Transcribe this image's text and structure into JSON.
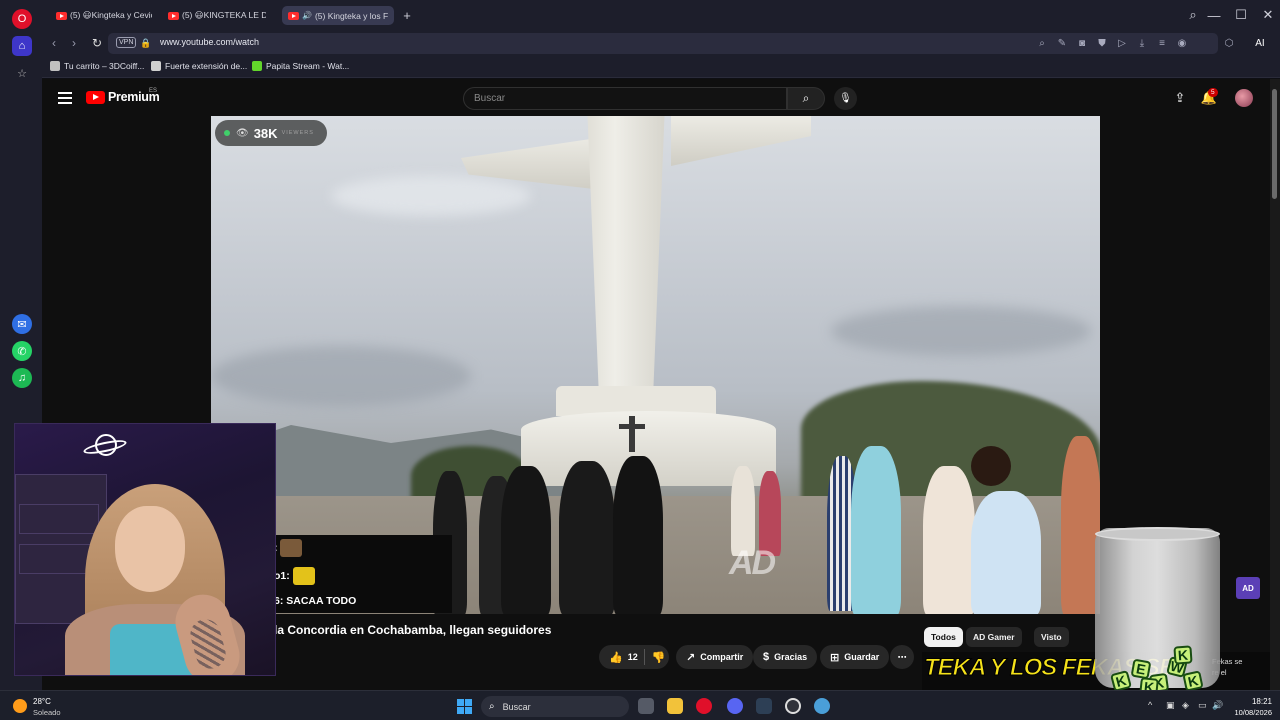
{
  "browser": {
    "tabs": [
      {
        "label": "(5) 😃Kingteka y Ceviche",
        "active": false
      },
      {
        "label": "(5) 😃KINGTEKA LE DA LA",
        "active": false
      },
      {
        "label": "(5) Kingteka y los FEK",
        "active": true
      }
    ],
    "new_tab_label": "+",
    "url": "www.youtube.com/watch",
    "vpn_label": "VPN",
    "ai_label": "AI",
    "bookmarks": [
      {
        "label": "Tu carrito – 3DCoiff...",
        "color": "#c0c0c0"
      },
      {
        "label": "Fuerte extensión de...",
        "color": "#d0d0d0"
      },
      {
        "label": "Papita Stream - Wat...",
        "color": "#63d62b"
      }
    ]
  },
  "youtube": {
    "logo_text": "Premium",
    "region": "ES",
    "search_placeholder": "Buscar",
    "notification_count": "5",
    "video": {
      "viewers_count": "38K",
      "viewers_label": "VIEWERS",
      "watermark": "AD"
    },
    "title": "la Concordia en Cochabamba, llegan seguidores",
    "actions": {
      "like_count": "12",
      "share": "Compartir",
      "thanks": "Gracias",
      "save": "Guardar"
    },
    "chips": [
      "Todos",
      "AD Gamer",
      "Visto"
    ],
    "rec_banner": "TEKA Y LOS FEKAS SE",
    "rec_side_text_1": "Fekas se",
    "rec_side_text_2": "re el",
    "ad_badge": "AD"
  },
  "stream_chat": {
    "lines": [
      {
        "prefix": ":",
        "has_emote": true,
        "emote_color": "#7a5a3a"
      },
      {
        "prefix": "o1:",
        "has_emote": true,
        "emote_color": "#e3c21a"
      },
      {
        "prefix": "6:",
        "text": "SACAA TODO"
      }
    ]
  },
  "kekw_letters": [
    "K",
    "E",
    "K",
    "W",
    "K",
    "K",
    "K"
  ],
  "taskbar": {
    "weather_temp": "28°C",
    "weather_cond": "Soleado",
    "search_label": "Buscar",
    "time": "18:21",
    "date": "10/08/2026"
  }
}
